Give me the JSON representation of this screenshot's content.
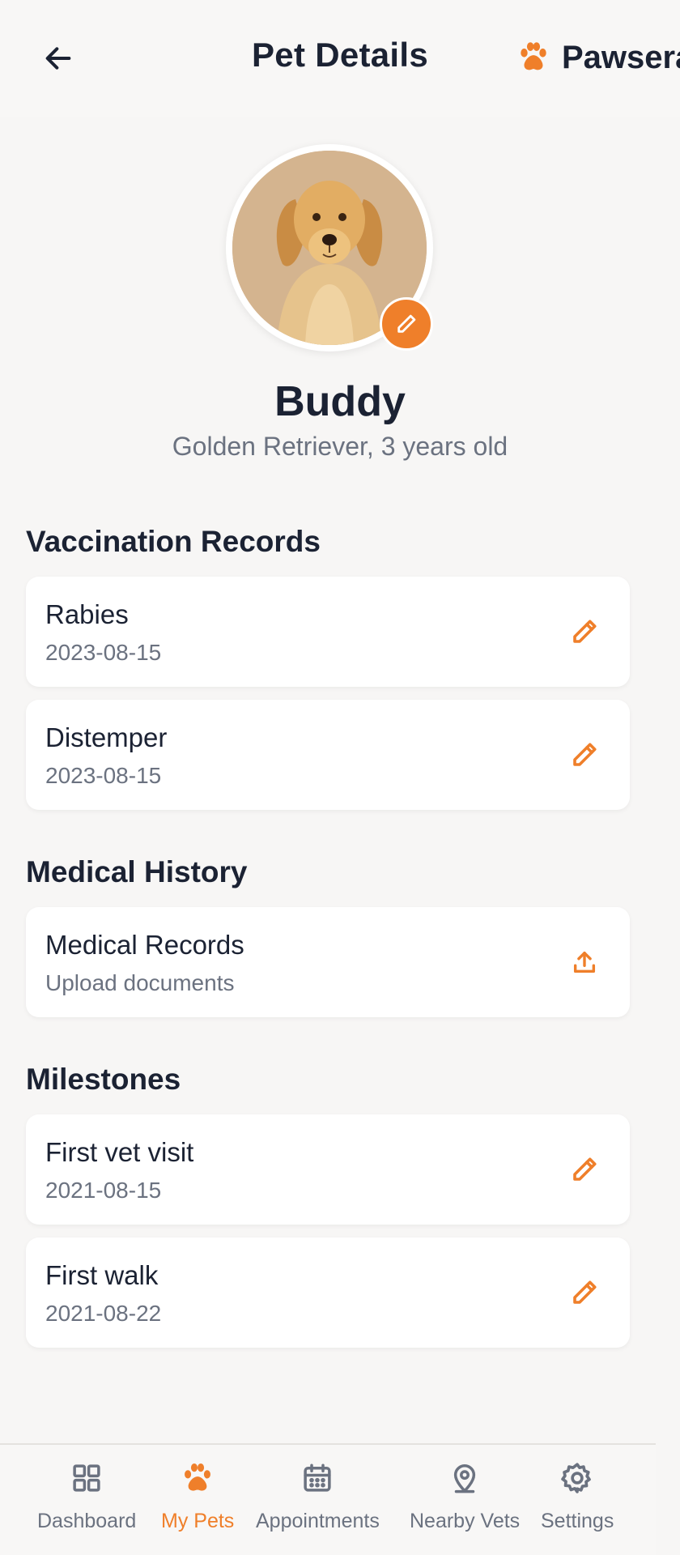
{
  "header": {
    "title": "Pet Details",
    "brand": "Pawsera",
    "back_icon": "arrow-left-icon",
    "brand_icon": "paw-icon"
  },
  "pet": {
    "name": "Buddy",
    "subtitle": "Golden Retriever, 3 years old",
    "photo": "golden-retriever-photo",
    "edit_icon": "pencil-icon"
  },
  "vaccination": {
    "title": "Vaccination Records",
    "items": [
      {
        "title": "Rabies",
        "date": "2023-08-15",
        "action_icon": "pencil-icon"
      },
      {
        "title": "Distemper",
        "date": "2023-08-15",
        "action_icon": "pencil-icon"
      }
    ]
  },
  "medical": {
    "title": "Medical History",
    "items": [
      {
        "title": "Medical Records",
        "subtitle": "Upload documents",
        "action_icon": "upload-icon"
      }
    ]
  },
  "milestones": {
    "title": "Milestones",
    "items": [
      {
        "title": "First vet visit",
        "date": "2021-08-15",
        "action_icon": "pencil-icon"
      },
      {
        "title": "First walk",
        "date": "2021-08-22",
        "action_icon": "pencil-icon"
      }
    ]
  },
  "nav": {
    "items": [
      {
        "label": "Dashboard",
        "icon": "grid-icon"
      },
      {
        "label": "My Pets",
        "icon": "paw-icon",
        "active": true
      },
      {
        "label": "Appointments",
        "icon": "calendar-icon"
      },
      {
        "label": "Nearby Vets",
        "icon": "map-pin-icon"
      },
      {
        "label": "Settings",
        "icon": "gear-icon"
      }
    ]
  },
  "colors": {
    "accent": "#ef7f2a",
    "text": "#1b2233",
    "muted": "#6b7280",
    "background": "#f7f6f5",
    "card": "#ffffff"
  }
}
